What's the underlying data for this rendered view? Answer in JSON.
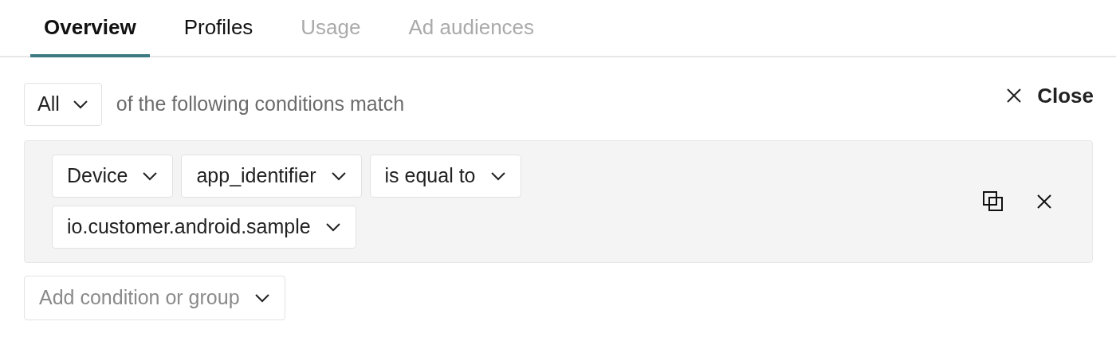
{
  "tabs": [
    {
      "label": "Overview",
      "selected": true,
      "disabled": false
    },
    {
      "label": "Profiles",
      "selected": false,
      "disabled": false
    },
    {
      "label": "Usage",
      "selected": false,
      "disabled": true
    },
    {
      "label": "Ad audiences",
      "selected": false,
      "disabled": true
    }
  ],
  "match": {
    "value": "All",
    "text": "of the following conditions match"
  },
  "close_label": "Close",
  "condition": {
    "dropdowns": [
      "Device",
      "app_identifier",
      "is equal to",
      "io.customer.android.sample"
    ]
  },
  "add": {
    "placeholder": "Add condition or group"
  }
}
